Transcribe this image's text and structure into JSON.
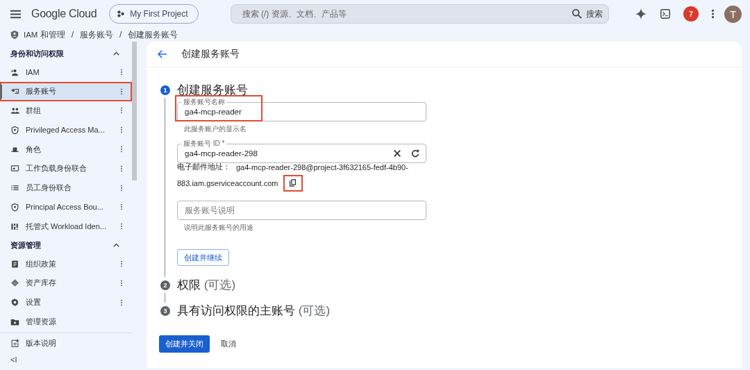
{
  "topbar": {
    "brand": "Google Cloud",
    "project": "My First Project",
    "search_placeholder": "搜索 (/) 资源、文档、产品等",
    "search_button": "搜索",
    "notifications": "7",
    "avatar": "T"
  },
  "breadcrumb": [
    "IAM 和管理",
    "/",
    "服务账号",
    "/",
    "创建服务账号"
  ],
  "sidebar": {
    "sections": [
      {
        "title": "身份和访问权限",
        "expanded": true,
        "items": [
          {
            "label": "IAM",
            "selected": false,
            "highlighted": false,
            "menu": true
          },
          {
            "label": "服务账号",
            "selected": true,
            "highlighted": true,
            "menu": true
          },
          {
            "label": "群组",
            "selected": false,
            "highlighted": false,
            "menu": true
          },
          {
            "label": "Privileged Access Ma...",
            "selected": false,
            "highlighted": false,
            "menu": true
          },
          {
            "label": "角色",
            "selected": false,
            "highlighted": false,
            "menu": true
          },
          {
            "label": "工作负载身份联合",
            "selected": false,
            "highlighted": false,
            "menu": true
          },
          {
            "label": "员工身份联合",
            "selected": false,
            "highlighted": false,
            "menu": true
          },
          {
            "label": "Principal Access Bou...",
            "selected": false,
            "highlighted": false,
            "menu": true
          },
          {
            "label": "托管式 Workload Iden...",
            "selected": false,
            "highlighted": false,
            "menu": true
          }
        ]
      },
      {
        "title": "资源管理",
        "expanded": true,
        "items": [
          {
            "label": "组织政策",
            "selected": false,
            "highlighted": false,
            "menu": true
          },
          {
            "label": "资产库存",
            "selected": false,
            "highlighted": false,
            "menu": true
          },
          {
            "label": "设置",
            "selected": false,
            "highlighted": false,
            "menu": true
          },
          {
            "label": "管理资源",
            "selected": false,
            "highlighted": false,
            "menu": false
          }
        ]
      }
    ],
    "footer": {
      "label": "版本说明",
      "collapse": "<I"
    }
  },
  "page": {
    "title": "创建服务账号",
    "steps": [
      {
        "number": "1",
        "title": "创建服务账号",
        "active": true,
        "fields": [
          {
            "label": "服务账号名称",
            "value": "ga4-mcp-reader",
            "hint": "此服务账户的显示名",
            "highlighted": true,
            "clear": false
          },
          {
            "label": "服务账号 ID *",
            "value": "ga4-mcp-reader-298",
            "clear": true,
            "highlighted": false,
            "email_label": "电子邮件地址：",
            "email_line1": "ga4-mcp-reader-298@project-3f632165-fedf-4b90-",
            "email_line2": "883.iam.gserviceaccount.com",
            "copy_highlighted": true
          },
          {
            "placeholder": "服务账号说明",
            "hint": "说明此服务账号的用途",
            "highlighted": false,
            "clear": false
          }
        ],
        "button": "创建并继续"
      },
      {
        "number": "2",
        "title": "权限",
        "optional": "(可选)",
        "active": false
      },
      {
        "number": "3",
        "title": "具有访问权限的主账号",
        "optional": "(可选)",
        "active": false
      }
    ],
    "actions": {
      "primary": "创建并关闭",
      "secondary": "取消"
    }
  }
}
